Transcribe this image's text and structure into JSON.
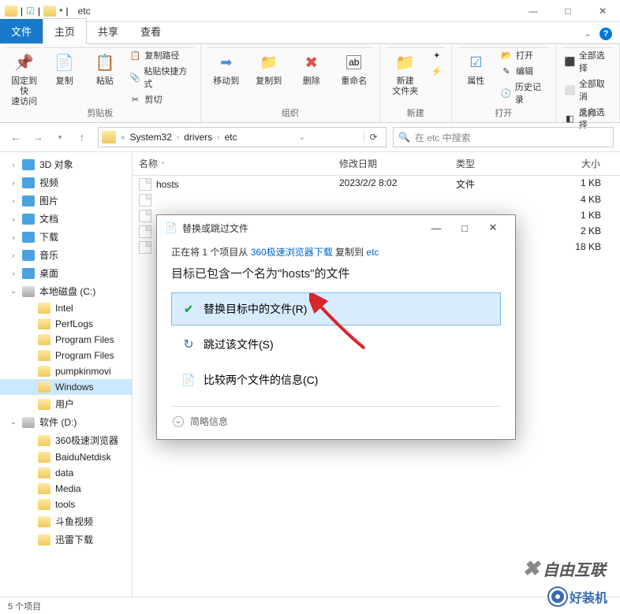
{
  "window": {
    "title": "etc",
    "qat_sep": "|"
  },
  "tabs": {
    "file": "文件",
    "home": "主页",
    "share": "共享",
    "view": "查看"
  },
  "ribbon": {
    "pin": "固定到快\n速访问",
    "copy": "复制",
    "paste": "粘贴",
    "copypath": "复制路径",
    "pastelink": "粘贴快捷方式",
    "cut": "剪切",
    "group_clip": "剪贴板",
    "moveto": "移动到",
    "copyto": "复制到",
    "delete": "删除",
    "rename": "重命名",
    "group_org": "组织",
    "newfolder": "新建\n文件夹",
    "group_new": "新建",
    "props": "属性",
    "open": "打开",
    "edit": "编辑",
    "history": "历史记录",
    "group_open": "打开",
    "selectall": "全部选择",
    "selectnone": "全部取消",
    "selectinv": "反向选择",
    "group_select": "选择"
  },
  "nav": {
    "back": "←",
    "fwd": "→",
    "up": "↑"
  },
  "breadcrumb": [
    "System32",
    "drivers",
    "etc"
  ],
  "search_placeholder": "在 etc 中搜索",
  "columns": {
    "name": "名称",
    "date": "修改日期",
    "type": "类型",
    "size": "大小"
  },
  "files": [
    {
      "name": "hosts",
      "date": "2023/2/2 8:02",
      "type": "文件",
      "size": "1 KB"
    },
    {
      "name": "",
      "date": "",
      "type": "",
      "size": "4 KB"
    },
    {
      "name": "",
      "date": "",
      "type": "",
      "size": "1 KB"
    },
    {
      "name": "",
      "date": "",
      "type": "",
      "size": "2 KB"
    },
    {
      "name": "",
      "date": "",
      "type": "",
      "size": "18 KB"
    }
  ],
  "tree": [
    {
      "label": "3D 对象",
      "ico": "blue",
      "indent": 0
    },
    {
      "label": "视频",
      "ico": "blue",
      "indent": 0
    },
    {
      "label": "图片",
      "ico": "blue",
      "indent": 0
    },
    {
      "label": "文档",
      "ico": "blue",
      "indent": 0
    },
    {
      "label": "下载",
      "ico": "blue",
      "indent": 0
    },
    {
      "label": "音乐",
      "ico": "blue",
      "indent": 0
    },
    {
      "label": "桌面",
      "ico": "blue",
      "indent": 0
    },
    {
      "label": "本地磁盘 (C:)",
      "ico": "drive",
      "indent": 0,
      "exp": true
    },
    {
      "label": "Intel",
      "ico": "folder",
      "indent": 1
    },
    {
      "label": "PerfLogs",
      "ico": "folder",
      "indent": 1
    },
    {
      "label": "Program Files",
      "ico": "folder",
      "indent": 1
    },
    {
      "label": "Program Files",
      "ico": "folder",
      "indent": 1
    },
    {
      "label": "pumpkinmovi",
      "ico": "folder",
      "indent": 1
    },
    {
      "label": "Windows",
      "ico": "folder",
      "indent": 1,
      "sel": true
    },
    {
      "label": "用户",
      "ico": "folder",
      "indent": 1
    },
    {
      "label": "软件 (D:)",
      "ico": "drive",
      "indent": 0,
      "exp": true
    },
    {
      "label": "360极速浏览器",
      "ico": "folder",
      "indent": 1
    },
    {
      "label": "BaiduNetdisk",
      "ico": "folder",
      "indent": 1
    },
    {
      "label": "data",
      "ico": "folder",
      "indent": 1
    },
    {
      "label": "Media",
      "ico": "folder",
      "indent": 1
    },
    {
      "label": "tools",
      "ico": "folder",
      "indent": 1
    },
    {
      "label": "斗鱼视频",
      "ico": "folder",
      "indent": 1
    },
    {
      "label": "迅雷下载",
      "ico": "folder",
      "indent": 1
    }
  ],
  "dialog": {
    "title": "替换或跳过文件",
    "src_prefix": "正在将 1 个项目从 ",
    "src_link": "360极速浏览器下载",
    "src_mid": " 复制到 ",
    "src_dest": "etc",
    "message": "目标已包含一个名为\"hosts\"的文件",
    "opt_replace": "替换目标中的文件(R)",
    "opt_skip": "跳过该文件(S)",
    "opt_compare": "比较两个文件的信息(C)",
    "footer": "简略信息"
  },
  "status": "5 个项目",
  "watermark1": "自由互联",
  "watermark2": "好装机"
}
